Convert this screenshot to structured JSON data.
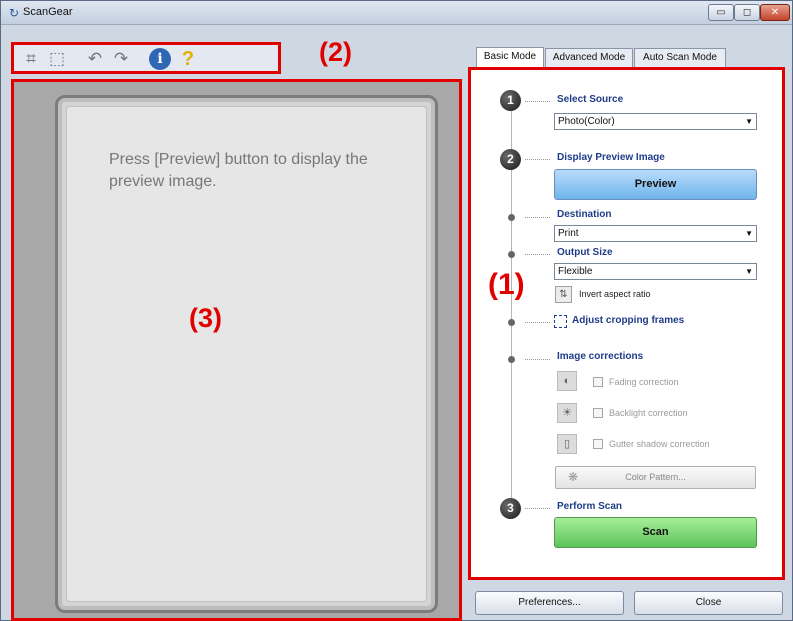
{
  "window": {
    "title": "ScanGear",
    "minimize_glyph": "▭",
    "maximize_glyph": "◻",
    "close_glyph": "✕"
  },
  "toolbar": {
    "icons": [
      "crop-icon",
      "remove-crop-icon",
      "rotate-left-icon",
      "rotate-right-icon",
      "info-icon",
      "help-icon"
    ],
    "info_glyph": "i",
    "help_glyph": "?"
  },
  "callouts": {
    "one": "(1)",
    "two": "(2)",
    "three": "(3)"
  },
  "preview": {
    "message": "Press [Preview] button to display the preview image."
  },
  "tabs": [
    {
      "label": "Basic Mode",
      "active": true
    },
    {
      "label": "Advanced Mode",
      "active": false
    },
    {
      "label": "Auto Scan Mode",
      "active": false
    }
  ],
  "panel": {
    "steps": [
      "1",
      "2",
      "3"
    ],
    "select_source": {
      "heading": "Select Source",
      "value": "Photo(Color)"
    },
    "display_preview": {
      "heading": "Display Preview Image",
      "button": "Preview"
    },
    "destination": {
      "heading": "Destination",
      "value": "Print"
    },
    "output_size": {
      "heading": "Output Size",
      "value": "Flexible",
      "invert_label": "Invert aspect ratio"
    },
    "adjust_cropping": {
      "label": "Adjust cropping frames"
    },
    "image_corrections": {
      "heading": "Image corrections",
      "fading": "Fading correction",
      "backlight": "Backlight correction",
      "gutter": "Gutter shadow correction",
      "color_pattern": "Color Pattern..."
    },
    "perform_scan": {
      "heading": "Perform Scan",
      "button": "Scan"
    }
  },
  "footer": {
    "preferences": "Preferences...",
    "close": "Close"
  },
  "colors": {
    "callout_red": "#e00000",
    "heading_blue": "#1f3c88",
    "preview_button": "#6fb4ec",
    "scan_button": "#5cc45a"
  }
}
